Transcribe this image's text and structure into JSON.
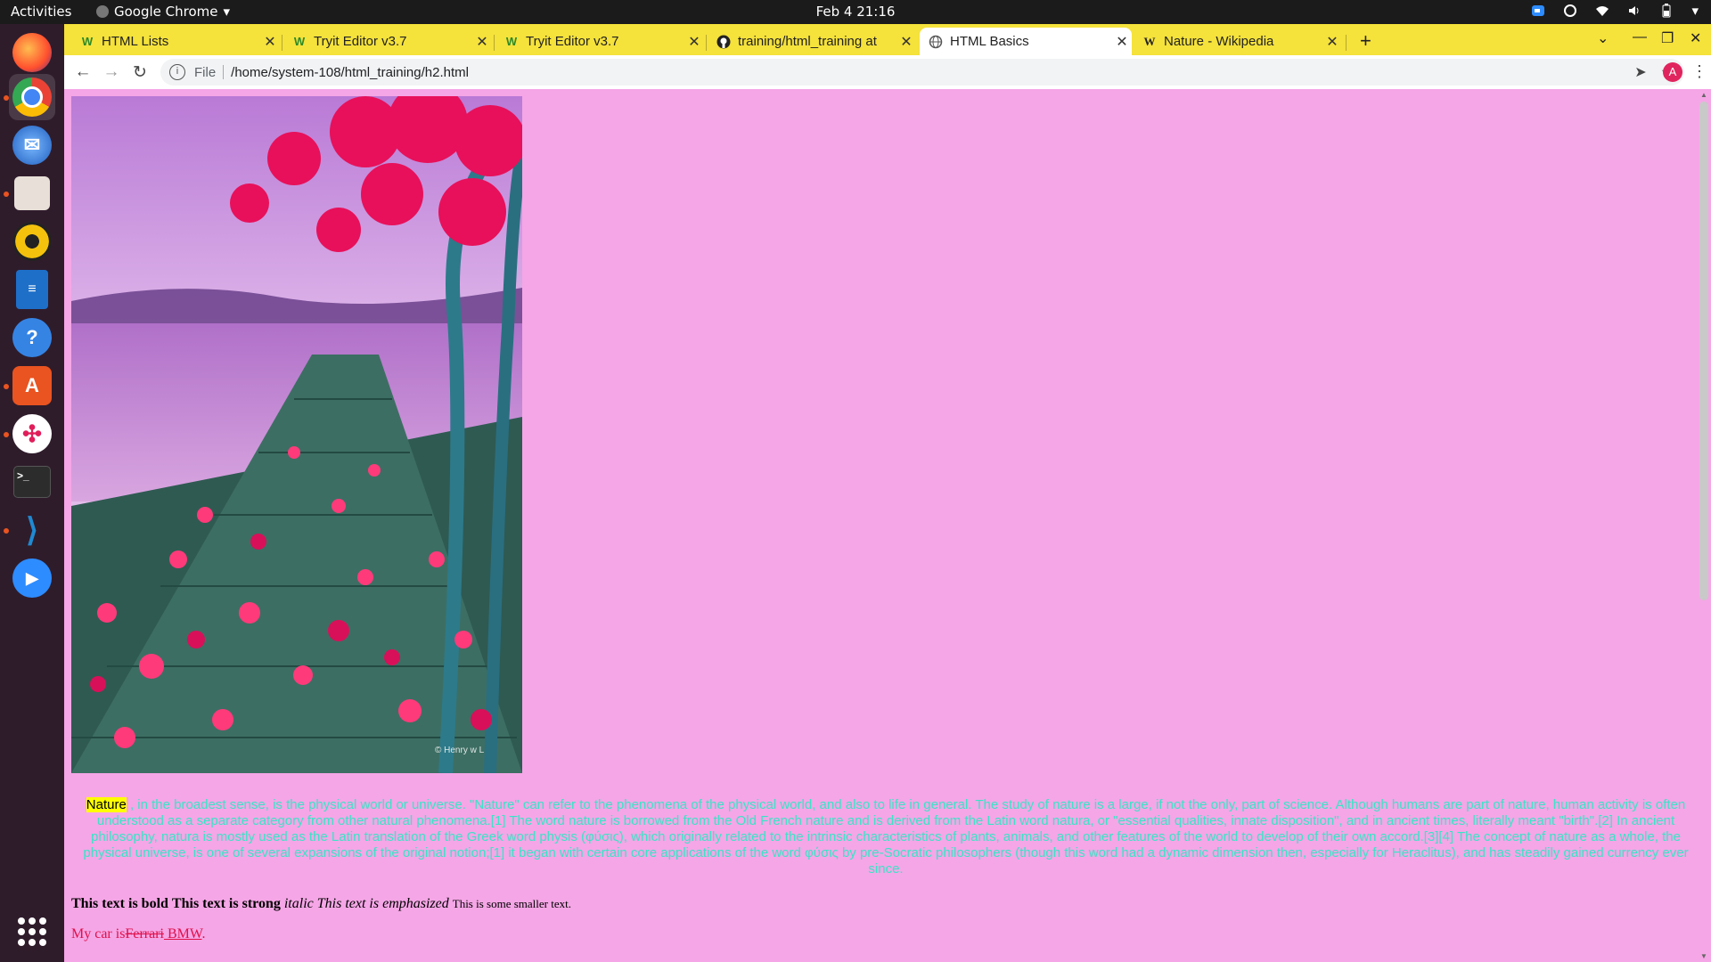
{
  "topbar": {
    "activities": "Activities",
    "app_name": "Google Chrome",
    "clock": "Feb 4  21:16"
  },
  "dock": {
    "items": [
      "firefox-icon",
      "chrome-icon",
      "thunderbird-icon",
      "files-icon",
      "rhythmbox-icon",
      "writer-icon",
      "help-icon",
      "software-icon",
      "slack-icon",
      "terminal-icon",
      "vscode-icon",
      "zoom-icon"
    ]
  },
  "tabs": [
    {
      "title": "HTML Lists",
      "favicon": "W"
    },
    {
      "title": "Tryit Editor v3.7",
      "favicon": "W"
    },
    {
      "title": "Tryit Editor v3.7",
      "favicon": "W"
    },
    {
      "title": "training/html_training at",
      "favicon": "github"
    },
    {
      "title": "HTML Basics",
      "favicon": "globe",
      "active": true
    },
    {
      "title": "Nature - Wikipedia",
      "favicon": "W"
    }
  ],
  "omnibox": {
    "scheme": "File",
    "url": "/home/system-108/html_training/h2.html"
  },
  "profile_initial": "A",
  "page": {
    "image_watermark": "© Henry w L",
    "nature_word": "Nature",
    "paragraph": " , in the broadest sense, is the physical world or universe. \"Nature\" can refer to the phenomena of the physical world, and also to life in general. The study of nature is a large, if not the only, part of science. Although humans are part of nature, human activity is often understood as a separate category from other natural phenomena.[1] The word nature is borrowed from the Old French nature and is derived from the Latin word natura, or \"essential qualities, innate disposition\", and in ancient times, literally meant \"birth\".[2] In ancient philosophy, natura is mostly used as the Latin translation of the Greek word physis (φύσις), which originally related to the intrinsic characteristics of plants, animals, and other features of the world to develop of their own accord.[3][4] The concept of nature as a whole, the physical universe, is one of several expansions of the original notion;[1] it began with certain core applications of the word φύσις by pre-Socratic philosophers (though this word had a dynamic dimension then, especially for Heraclitus), and has steadily gained currency ever since.",
    "bold_text": "This text is bold",
    "strong_text": "This text is strong",
    "italic_text": "italic",
    "em_text": "This text is emphasized",
    "small_text": "This is some smaller text.",
    "car_prefix": "My car is",
    "car_deleted": "Ferrari",
    "car_inserted": " BMW",
    "car_suffix": "."
  }
}
